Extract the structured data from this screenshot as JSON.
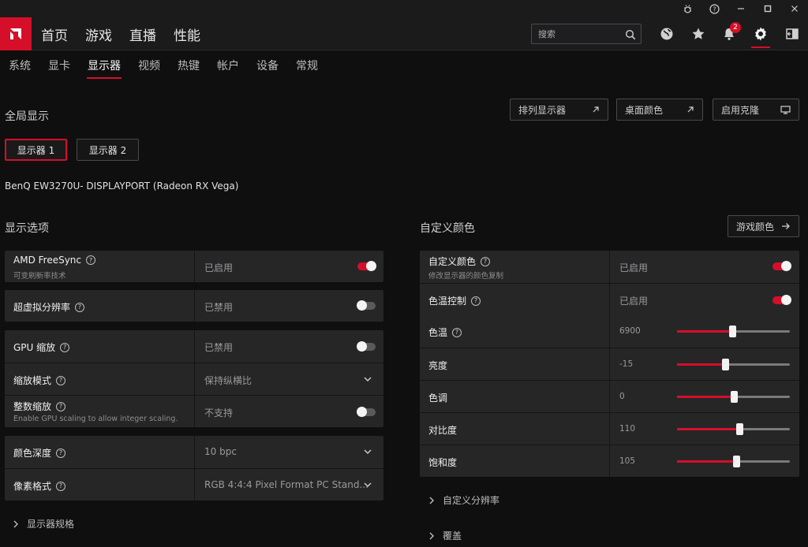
{
  "header": {
    "nav": [
      "首页",
      "游戏",
      "直播",
      "性能"
    ],
    "search_placeholder": "搜索",
    "notification_count": "2"
  },
  "tabs": [
    {
      "label": "系统",
      "active": false
    },
    {
      "label": "显卡",
      "active": false
    },
    {
      "label": "显示器",
      "active": true
    },
    {
      "label": "视频",
      "active": false
    },
    {
      "label": "热键",
      "active": false
    },
    {
      "label": "帐户",
      "active": false
    },
    {
      "label": "设备",
      "active": false
    },
    {
      "label": "常规",
      "active": false
    }
  ],
  "global_display": {
    "title": "全局显示",
    "arrange_label": "排列显示器",
    "desktop_color_label": "桌面颜色",
    "clone_label": "启用克隆"
  },
  "displays": [
    "显示器 1",
    "显示器 2"
  ],
  "monitor_name": "BenQ EW3270U- DISPLAYPORT (Radeon RX Vega)",
  "display_options": {
    "title": "显示选项",
    "freesync": {
      "label": "AMD FreeSync",
      "sub": "可变刷新率技术",
      "value": "已启用",
      "on": true
    },
    "vsr": {
      "label": "超虚拟分辨率",
      "value": "已禁用",
      "on": false
    },
    "gpu_scaling": {
      "label": "GPU 缩放",
      "value": "已禁用",
      "on": false
    },
    "scaling_mode": {
      "label": "缩放模式",
      "value": "保持纵横比"
    },
    "integer_scaling": {
      "label": "整数缩放",
      "sub": "Enable GPU scaling to allow integer scaling.",
      "value": "不支持",
      "on": false
    },
    "color_depth": {
      "label": "颜色深度",
      "value": "10 bpc"
    },
    "pixel_format": {
      "label": "像素格式",
      "value": "RGB 4:4:4 Pixel Format PC Stand..."
    },
    "specs_label": "显示器规格"
  },
  "custom_color": {
    "title": "自定义颜色",
    "game_color_label": "游戏颜色",
    "custom": {
      "label": "自定义颜色",
      "sub": "修改显示器的颜色复制",
      "value": "已启用",
      "on": true
    },
    "temp_control": {
      "label": "色温控制",
      "value": "已启用",
      "on": true
    },
    "sliders": [
      {
        "label": "色温",
        "value": "6900",
        "help": true,
        "fraction": 0.49
      },
      {
        "label": "亮度",
        "value": "-15",
        "help": false,
        "fraction": 0.43
      },
      {
        "label": "色调",
        "value": "0",
        "help": false,
        "fraction": 0.5
      },
      {
        "label": "对比度",
        "value": "110",
        "help": false,
        "fraction": 0.55
      },
      {
        "label": "饱和度",
        "value": "105",
        "help": false,
        "fraction": 0.525
      }
    ],
    "custom_resolution_label": "自定义分辨率",
    "overlay_label": "覆盖"
  },
  "colors": {
    "accent": "#d50f29"
  }
}
